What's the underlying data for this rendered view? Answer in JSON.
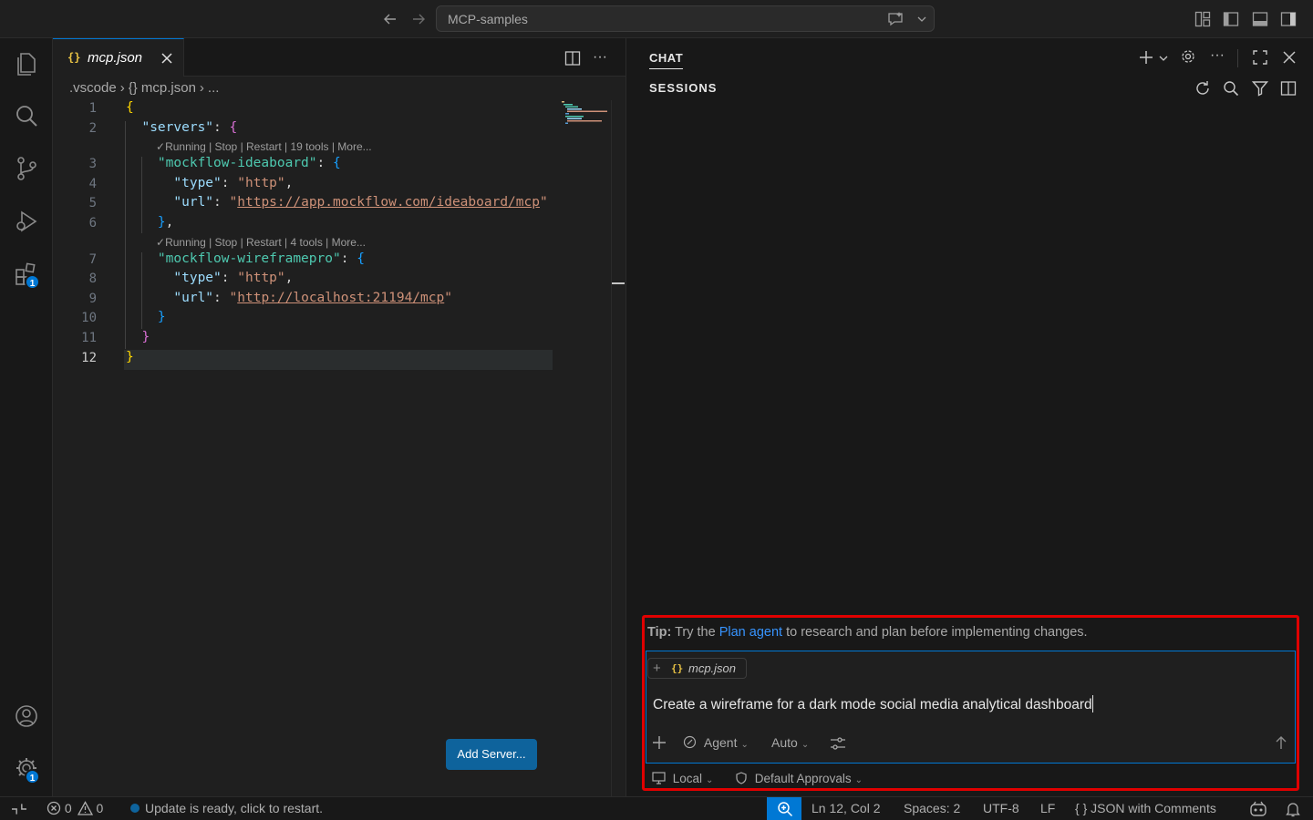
{
  "titlebar": {
    "search_title": "MCP-samples"
  },
  "activity": {
    "extensions_badge": "1",
    "settings_badge": "1"
  },
  "editor": {
    "tab_label": "mcp.json",
    "tab_icon": "{}",
    "breadcrumb": [
      ".vscode",
      "{} mcp.json",
      "..."
    ],
    "lens1": "Running | Stop | Restart | 19 tools | More...",
    "lens2": "Running | Stop | Restart | 4 tools | More...",
    "line_numbers": [
      "1",
      "2",
      "3",
      "4",
      "5",
      "6",
      "7",
      "8",
      "9",
      "10",
      "11",
      "12"
    ],
    "code": {
      "l2_key": "\"servers\"",
      "l3_key": "\"mockflow-ideaboard\"",
      "l4_key": "\"type\"",
      "l4_val": "\"http\"",
      "l5_key": "\"url\"",
      "l5_q": "\"",
      "l5_val": "https://app.mockflow.com/ideaboard/mcp",
      "l7_key": "\"mockflow-wireframepro\"",
      "l8_key": "\"type\"",
      "l8_val": "\"http\"",
      "l9_key": "\"url\"",
      "l9_val": "http://localhost:21194/mcp"
    },
    "add_server_label": "Add Server..."
  },
  "chat": {
    "title": "CHAT",
    "sessions_label": "SESSIONS",
    "tip_prefix": "Tip:",
    "tip_before": " Try the ",
    "tip_link": "Plan agent",
    "tip_after": " to research and plan before implementing changes.",
    "attachment_name": "mcp.json",
    "attachment_icon": "{}",
    "input_text": "Create a wireframe for a dark mode social media analytical dashboard",
    "mode_label": "Agent",
    "model_label": "Auto",
    "location_label": "Local",
    "approvals_label": "Default Approvals"
  },
  "statusbar": {
    "errors": "0",
    "warnings": "0",
    "update_message": "Update is ready, click to restart.",
    "position": "Ln 12, Col 2",
    "spaces": "Spaces: 2",
    "encoding": "UTF-8",
    "eol": "LF",
    "language": "{ }  JSON with Comments"
  },
  "colors": {
    "accent": "#0078d4",
    "highlight_box": "#e00000",
    "link": "#3794ff"
  }
}
